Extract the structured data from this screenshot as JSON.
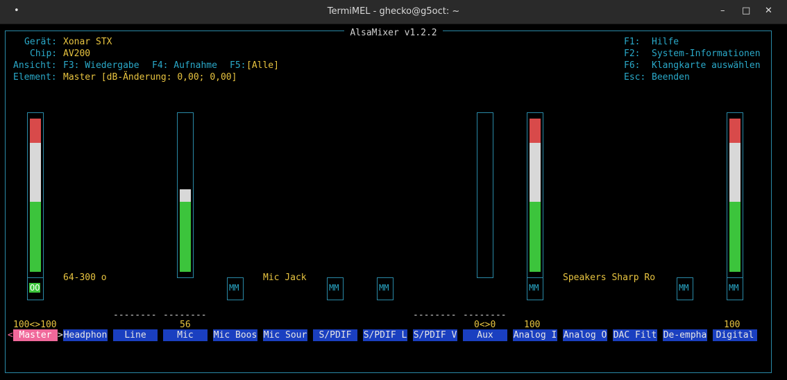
{
  "window": {
    "title": "TermiMEL - ghecko@g5oct: ~",
    "menu_glyph": "•",
    "minimize": "–",
    "maximize": "□",
    "close": "✕"
  },
  "app": {
    "title": "AlsaMixer v1.2.2"
  },
  "info": {
    "device_label": "Gerät:",
    "device_value": "Xonar STX",
    "chip_label": "Chip:",
    "chip_value": "AV200",
    "view_label": "Ansicht:",
    "view_f3": "F3: Wiedergabe",
    "view_f4": "F4: Aufnahme",
    "view_f5": "F5:",
    "view_f5_value": "[Alle]",
    "element_label": "Element:",
    "element_value": "Master [dB-Änderung: 0,00; 0,00]"
  },
  "help": [
    {
      "key": "F1:",
      "text": "Hilfe"
    },
    {
      "key": "F2:",
      "text": "System-Informationen"
    },
    {
      "key": "F6:",
      "text": "Klangkarte auswählen"
    },
    {
      "key": "Esc:",
      "text": "Beenden"
    }
  ],
  "enums": {
    "headphones": "64-300 o",
    "mic_jack": "Mic Jack",
    "speakers": "Speakers Sharp Ro"
  },
  "controls": {
    "master": {
      "label": "Master",
      "left_arrow": "<",
      "right_arrow": ">",
      "value": "100<>100",
      "switch": "OO",
      "level_pct": 100
    },
    "headphones": {
      "label": "Headphon"
    },
    "line": {
      "label": "Line",
      "dashes": "--------"
    },
    "mic": {
      "label": "Mic",
      "dashes": "--------",
      "value": "56",
      "level_pct": 56
    },
    "mic_boost": {
      "label": "Mic Boos",
      "switch": "MM"
    },
    "mic_source": {
      "label": "Mic Sour",
      "switch": "MM"
    },
    "spdif": {
      "label": "S/PDIF",
      "switch": "MM"
    },
    "spdif_l": {
      "label": "S/PDIF L"
    },
    "spdif_v": {
      "label": "S/PDIF V",
      "dashes": "--------"
    },
    "aux": {
      "label": "Aux",
      "dashes": "--------",
      "value": "0<>0",
      "level_pct": 0
    },
    "analog_in": {
      "label": "Analog I",
      "value": "100",
      "switch": "MM",
      "level_pct": 100
    },
    "analog_out": {
      "label": "Analog O"
    },
    "dac_filter": {
      "label": "DAC Filt"
    },
    "de_emphasis": {
      "label": "De-empha",
      "switch": "MM"
    },
    "digital": {
      "label": "Digital",
      "value": "100",
      "switch": "MM",
      "level_pct": 100
    }
  },
  "colors": {
    "frame": "#2a8aa8",
    "label_bg": "#1a3fc0",
    "selected_bg": "#f0689a",
    "gauge_red": "#d84a4a",
    "gauge_white": "#d8d8d8",
    "gauge_green": "#3cc43c"
  }
}
